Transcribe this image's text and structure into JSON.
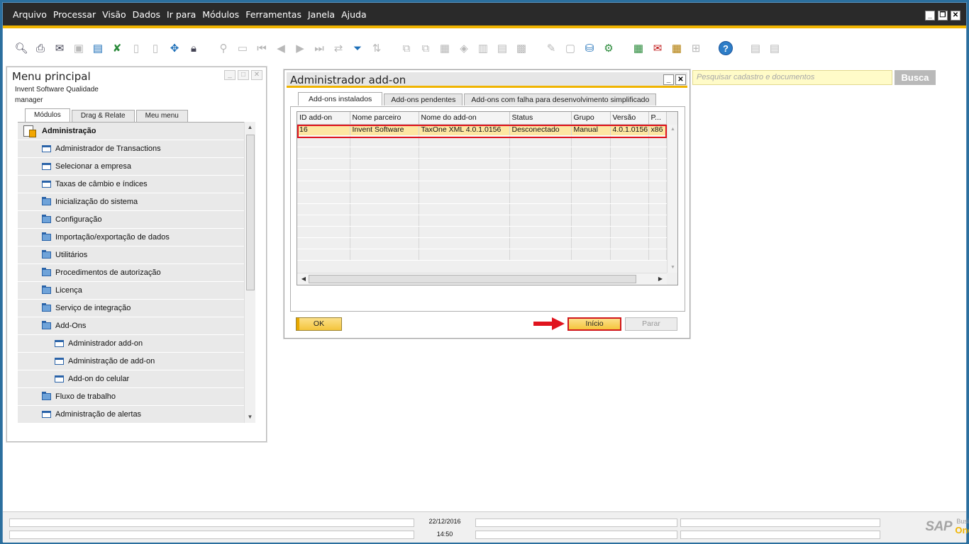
{
  "menubar": {
    "items": [
      "Arquivo",
      "Processar",
      "Visão",
      "Dados",
      "Ir para",
      "Módulos",
      "Ferramentas",
      "Janela",
      "Ajuda"
    ]
  },
  "toolbar": {
    "icons": [
      "preview-icon",
      "print-icon",
      "email-icon",
      "sms-icon",
      "fax-icon",
      "export-excel-icon",
      "export-word-icon",
      "export-pdf-icon",
      "launch-app-icon",
      "lock-screen-icon",
      "find-icon",
      "add-icon",
      "first-record-icon",
      "previous-record-icon",
      "next-record-icon",
      "last-record-icon",
      "refresh-icon",
      "filter-icon",
      "sort-icon",
      "base-document-icon",
      "target-document-icon",
      "drill-down-icon",
      "gross-profit-icon",
      "payment-means-icon",
      "volume-weight-icon",
      "journal-icon",
      "settings-icon",
      "edit-icon",
      "database-icon",
      "tools-icon",
      "calendar-icon",
      "messages-icon",
      "planning-icon",
      "structure-icon",
      "help-icon",
      "form-settings-icon",
      "print-layout-icon"
    ],
    "help_glyph": "?"
  },
  "main_menu": {
    "title": "Menu principal",
    "company": "Invent Software Qualidade",
    "user": "manager",
    "tabs": [
      "Módulos",
      "Drag & Relate",
      "Meu menu"
    ],
    "items": [
      {
        "label": "Administração",
        "level": 0
      },
      {
        "label": "Administrador de Transactions",
        "level": 1,
        "kind": "doc"
      },
      {
        "label": "Selecionar a empresa",
        "level": 1,
        "kind": "doc"
      },
      {
        "label": "Taxas de câmbio e índices",
        "level": 1,
        "kind": "doc"
      },
      {
        "label": "Inicialização do sistema",
        "level": 1,
        "kind": "folder"
      },
      {
        "label": "Configuração",
        "level": 1,
        "kind": "folder"
      },
      {
        "label": "Importação/exportação de dados",
        "level": 1,
        "kind": "folder"
      },
      {
        "label": "Utilitários",
        "level": 1,
        "kind": "folder"
      },
      {
        "label": "Procedimentos de autorização",
        "level": 1,
        "kind": "folder"
      },
      {
        "label": "Licença",
        "level": 1,
        "kind": "folder"
      },
      {
        "label": "Serviço de integração",
        "level": 1,
        "kind": "folder"
      },
      {
        "label": "Add-Ons",
        "level": 1,
        "kind": "folder-open"
      },
      {
        "label": "Administrador add-on",
        "level": 2,
        "kind": "doc"
      },
      {
        "label": "Administração de add-on",
        "level": 2,
        "kind": "doc"
      },
      {
        "label": "Add-on do celular",
        "level": 2,
        "kind": "doc"
      },
      {
        "label": "Fluxo de trabalho",
        "level": 1,
        "kind": "folder"
      },
      {
        "label": "Administração de alertas",
        "level": 1,
        "kind": "doc"
      }
    ]
  },
  "search": {
    "placeholder": "Pesquisar cadastro e documentos",
    "button": "Busca"
  },
  "dialog": {
    "title": "Administrador add-on",
    "tabs": [
      "Add-ons instalados",
      "Add-ons pendentes",
      "Add-ons com falha para desenvolvimento simplificado"
    ],
    "columns": [
      "ID add-on",
      "Nome parceiro",
      "Nome do add-on",
      "Status",
      "Grupo",
      "Versão",
      "P..."
    ],
    "rows": [
      [
        "16",
        "Invent Software",
        "TaxOne XML 4.0.1.0156",
        "Desconectado",
        "Manual",
        "4.0.1.0156",
        "x86"
      ]
    ],
    "buttons": {
      "ok": "OK",
      "start": "Início",
      "stop": "Parar"
    }
  },
  "statusbar": {
    "date": "22/12/2016",
    "time": "14:50",
    "logo": {
      "sap": "SAP",
      "business": "Business",
      "one": "One"
    }
  },
  "colors": {
    "accent": "#f0b400",
    "highlight_row": "#fde6a2",
    "annotation_red": "#e0141e",
    "menubar_bg": "#2a2a2a"
  }
}
